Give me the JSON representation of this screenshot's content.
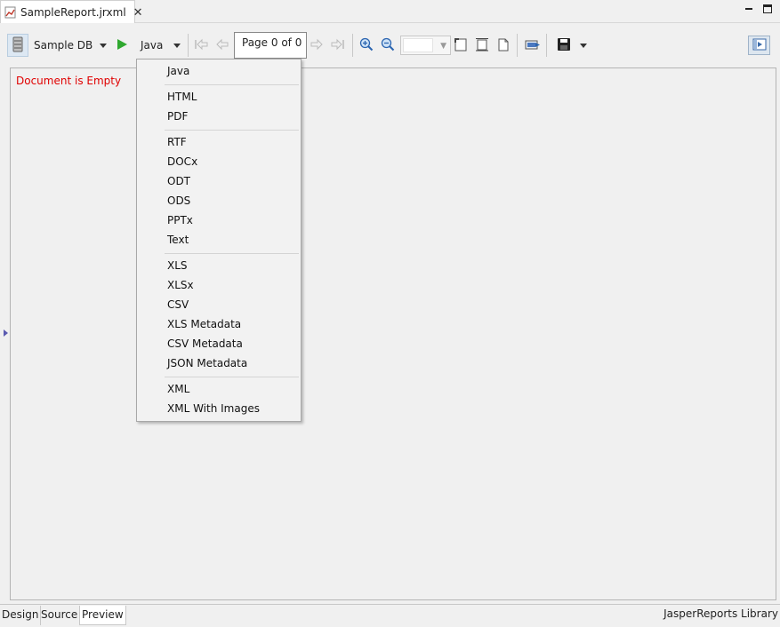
{
  "editor": {
    "tab_title": "SampleReport.jrxml",
    "close_glyph": "✕",
    "icons": {
      "file": "report-file-icon",
      "minimize": "minimize-icon",
      "maximize": "maximize-icon"
    }
  },
  "toolbar": {
    "datasource": "Sample DB",
    "export_format": "Java",
    "page_indicator": "Page 0 of 0",
    "zoom_value": "",
    "icons": [
      "datasource-icon",
      "run-icon",
      "first-page-icon",
      "previous-page-icon",
      "next-page-icon",
      "last-page-icon",
      "zoom-in-icon",
      "zoom-out-icon",
      "fit-page-icon",
      "fit-width-icon",
      "actual-size-icon",
      "export-icon",
      "save-icon",
      "toggle-view-icon"
    ]
  },
  "preview": {
    "message": "Document is Empty",
    "message_color": "#e00000"
  },
  "export_menu": {
    "items": [
      "Java",
      "HTML",
      "PDF",
      "RTF",
      "DOCx",
      "ODT",
      "ODS",
      "PPTx",
      "Text",
      "XLS",
      "XLSx",
      "CSV",
      "XLS Metadata",
      "CSV Metadata",
      "JSON Metadata",
      "XML",
      "XML With Images"
    ]
  },
  "bottom_tabs": {
    "design": "Design",
    "source": "Source",
    "preview": "Preview",
    "library": "JasperReports Library"
  }
}
